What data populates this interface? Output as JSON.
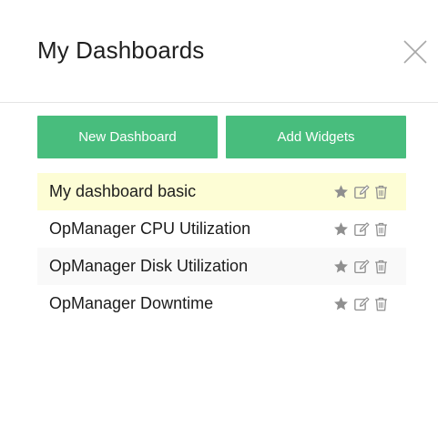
{
  "dialog": {
    "title": "My Dashboards"
  },
  "buttons": {
    "new_dashboard": "New Dashboard",
    "add_widgets": "Add Widgets"
  },
  "dashboards": [
    {
      "label": "My dashboard basic"
    },
    {
      "label": "OpManager CPU Utilization"
    },
    {
      "label": "OpManager Disk Utilization"
    },
    {
      "label": "OpManager Downtime"
    }
  ],
  "icons": {
    "close": "close-icon",
    "favorite": "star-icon",
    "edit": "edit-icon",
    "delete": "trash-icon"
  },
  "colors": {
    "accent": "#48bd7d",
    "selected_row": "#fdfdd5",
    "icon_gray": "#8f8f8f"
  }
}
